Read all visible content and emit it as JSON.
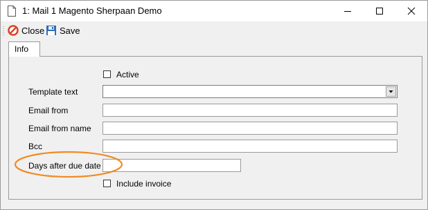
{
  "window": {
    "title": "1: Mail 1 Magento Sherpaan Demo",
    "icons": {
      "app": "document-icon",
      "minimize": "minimize-icon",
      "maximize": "maximize-icon",
      "close": "close-icon"
    }
  },
  "toolbar": {
    "close_label": "Close",
    "save_label": "Save",
    "close_icon": "cancel-icon",
    "save_icon": "floppy-disk-icon"
  },
  "tabs": [
    {
      "label": "Info",
      "selected": true
    }
  ],
  "form": {
    "active_label": "Active",
    "active_checked": false,
    "template_text_label": "Template text",
    "template_text_value": "",
    "email_from_label": "Email from",
    "email_from_value": "",
    "email_from_name_label": "Email from name",
    "email_from_name_value": "",
    "bcc_label": "Bcc",
    "bcc_value": "",
    "days_after_due_date_label": "Days after due date",
    "days_after_due_date_value": "",
    "include_invoice_label": "Include invoice",
    "include_invoice_checked": false
  },
  "annotation": {
    "shape": "ellipse",
    "color": "#f08a24",
    "target": "Days after due date"
  },
  "colors": {
    "highlight": "#f08a24",
    "close_icon_red": "#d9442a",
    "save_icon_blue": "#2f6db5"
  }
}
